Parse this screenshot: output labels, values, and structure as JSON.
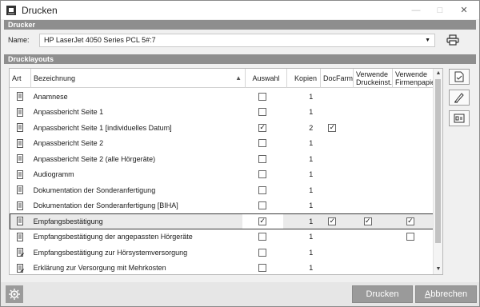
{
  "window": {
    "title": "Drucken"
  },
  "printer": {
    "section_title": "Drucker",
    "label": "Name:",
    "selected": "HP LaserJet 4050 Series PCL 5#:7"
  },
  "layouts": {
    "section_title": "Drucklayouts",
    "headers": {
      "art": "Art",
      "bezeichnung": "Bezeichnung",
      "auswahl": "Auswahl",
      "kopien": "Kopien",
      "docfarm": "DocFarm",
      "druckeinst_1": "Verwende",
      "druckeinst_2": "Druckeinst.",
      "firmen_1": "Verwende",
      "firmen_2": "Firmenpapier"
    },
    "rows": [
      {
        "name": "Anamnese",
        "icon": "document-icon",
        "auswahl": false,
        "kopien": "1",
        "docfarm": null,
        "druck": null,
        "firmen": null
      },
      {
        "name": "Anpassbericht Seite 1",
        "icon": "document-icon",
        "auswahl": false,
        "kopien": "1",
        "docfarm": null,
        "druck": null,
        "firmen": null
      },
      {
        "name": "Anpassbericht Seite 1 [individuelles Datum]",
        "icon": "document-icon",
        "auswahl": true,
        "kopien": "2",
        "docfarm": true,
        "druck": null,
        "firmen": null
      },
      {
        "name": "Anpassbericht Seite 2",
        "icon": "document-icon",
        "auswahl": false,
        "kopien": "1",
        "docfarm": null,
        "druck": null,
        "firmen": null
      },
      {
        "name": "Anpassbericht Seite 2 (alle Hörgeräte)",
        "icon": "document-icon",
        "auswahl": false,
        "kopien": "1",
        "docfarm": null,
        "druck": null,
        "firmen": null
      },
      {
        "name": "Audiogramm",
        "icon": "document-icon",
        "auswahl": false,
        "kopien": "1",
        "docfarm": null,
        "druck": null,
        "firmen": null
      },
      {
        "name": "Dokumentation der Sonderanfertigung",
        "icon": "document-icon",
        "auswahl": false,
        "kopien": "1",
        "docfarm": null,
        "druck": null,
        "firmen": null
      },
      {
        "name": "Dokumentation der Sonderanfertigung [BIHA]",
        "icon": "document-icon",
        "auswahl": false,
        "kopien": "1",
        "docfarm": null,
        "druck": null,
        "firmen": null
      },
      {
        "name": "Empfangsbestätigung",
        "icon": "document-icon",
        "auswahl": true,
        "kopien": "1",
        "docfarm": true,
        "druck": true,
        "firmen": true,
        "selected": true
      },
      {
        "name": "Empfangsbestätigung der angepassten Hörgeräte",
        "icon": "document-icon",
        "auswahl": false,
        "kopien": "1",
        "docfarm": null,
        "druck": null,
        "firmen": false
      },
      {
        "name": "Empfangsbestätigung zur Hörsystemversorgung",
        "icon": "document-edit-icon",
        "auswahl": false,
        "kopien": "1",
        "docfarm": null,
        "druck": null,
        "firmen": null
      },
      {
        "name": "Erklärung zur Versorgung mit Mehrkosten",
        "icon": "document-edit-icon",
        "auswahl": false,
        "kopien": "1",
        "docfarm": null,
        "druck": null,
        "firmen": null
      }
    ]
  },
  "buttons": {
    "print": "Drucken",
    "cancel_underlined": "A",
    "cancel_rest": "bbrechen"
  },
  "colors": {
    "section_header": "#8e8e8e",
    "footer_button": "#9a9a9a",
    "selected_row": "#eaeaea"
  }
}
